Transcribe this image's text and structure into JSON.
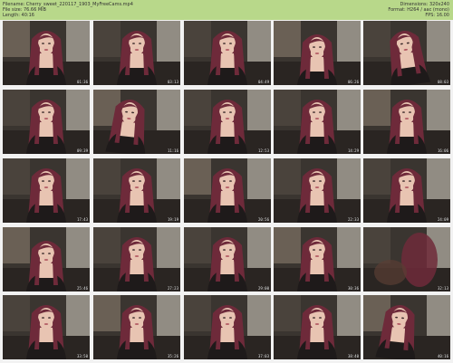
{
  "header": {
    "filename_label": "Filename:",
    "filename": "Cherry_sweet_220117_1903_MyFreeCams.mp4",
    "filesize_label": "File size:",
    "filesize": "76.66 MiB",
    "length_label": "Length:",
    "length": "40:16",
    "dimensions_label": "Dimensions:",
    "dimensions": "320x240",
    "format_label": "Format:",
    "format": "H264 / aac (mono)",
    "fps_label": "FPS:",
    "fps": "16.00"
  },
  "thumbnails": [
    {
      "time": "01:36",
      "pose": "frontal"
    },
    {
      "time": "03:13",
      "pose": "frontal"
    },
    {
      "time": "04:49",
      "pose": "frontal"
    },
    {
      "time": "06:26",
      "pose": "down"
    },
    {
      "time": "08:03",
      "pose": "tilt"
    },
    {
      "time": "09:39",
      "pose": "frontal"
    },
    {
      "time": "11:16",
      "pose": "side"
    },
    {
      "time": "12:53",
      "pose": "frontal"
    },
    {
      "time": "14:29",
      "pose": "frontal"
    },
    {
      "time": "16:06",
      "pose": "frontal"
    },
    {
      "time": "17:43",
      "pose": "frontal"
    },
    {
      "time": "19:19",
      "pose": "frontal"
    },
    {
      "time": "20:56",
      "pose": "frontal"
    },
    {
      "time": "22:33",
      "pose": "frontal"
    },
    {
      "time": "24:09",
      "pose": "frontal"
    },
    {
      "time": "25:46",
      "pose": "down"
    },
    {
      "time": "27:23",
      "pose": "frontal"
    },
    {
      "time": "29:00",
      "pose": "frontal"
    },
    {
      "time": "30:36",
      "pose": "frontal"
    },
    {
      "time": "32:13",
      "pose": "blur"
    },
    {
      "time": "33:50",
      "pose": "frontal"
    },
    {
      "time": "35:26",
      "pose": "frontal"
    },
    {
      "time": "37:03",
      "pose": "frontal"
    },
    {
      "time": "38:40",
      "pose": "frontal"
    },
    {
      "time": "40:16",
      "pose": "side"
    }
  ],
  "colors": {
    "header_bg": "#b8d88a",
    "hair": "#6e2a3a",
    "skin": "#e8c4b2",
    "room": "#3a3530",
    "wall": "#d9d4c8"
  }
}
